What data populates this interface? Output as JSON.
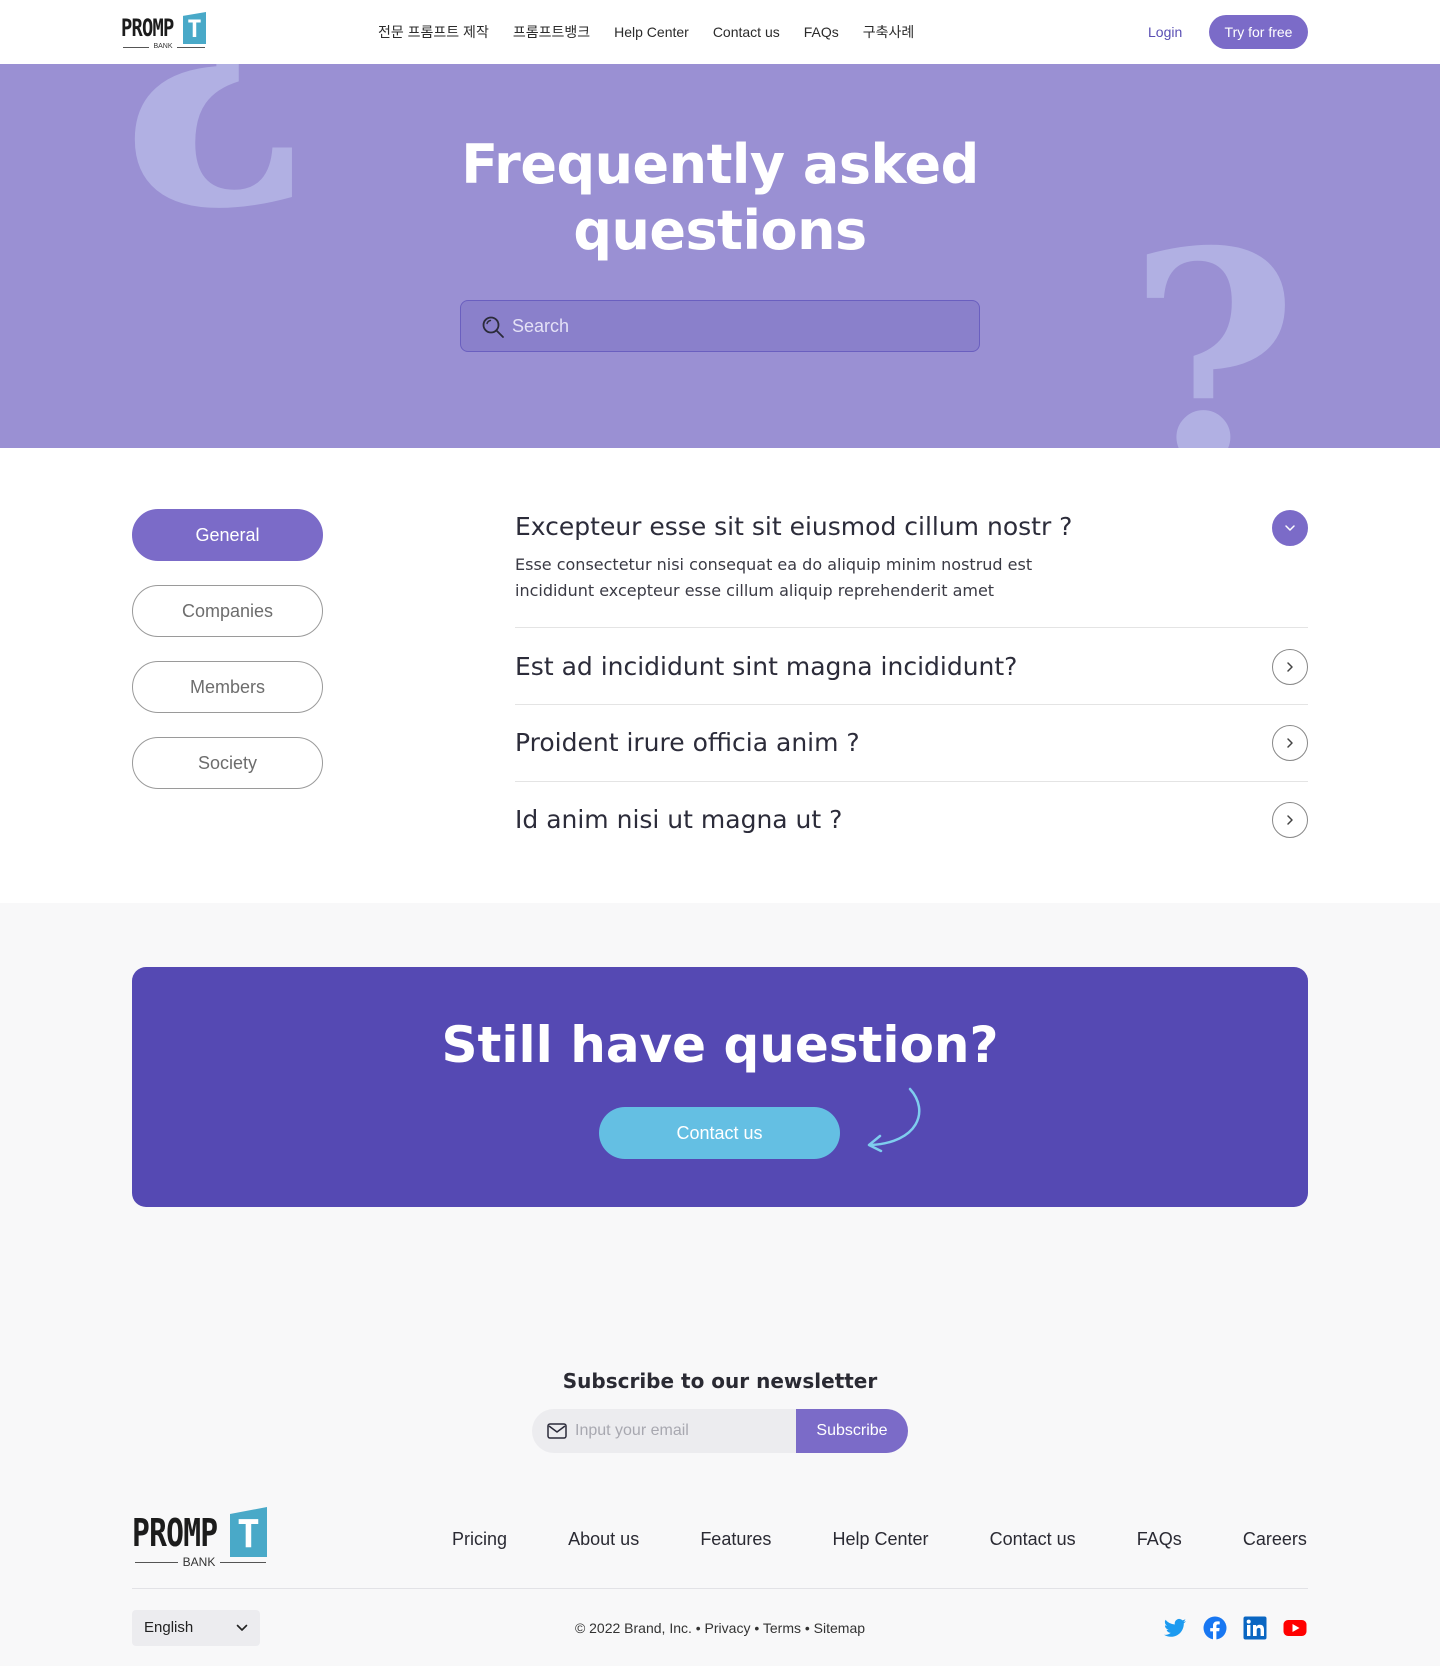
{
  "header": {
    "logo": {
      "word": "PROMP",
      "t_letter": "T",
      "sub": "BANK"
    },
    "nav": [
      "전문 프롬프트 제작",
      "프롬프트뱅크",
      "Help Center",
      "Contact us",
      "FAQs",
      "구축사례"
    ],
    "login": "Login",
    "cta": "Try for free"
  },
  "hero": {
    "title_line1": "Frequently asked",
    "title_line2": "questions",
    "search_placeholder": "Search",
    "decor_glyph": "?"
  },
  "categories": [
    "General",
    "Companies",
    "Members",
    "Society"
  ],
  "active_category": "General",
  "faq": [
    {
      "question": "Excepteur esse sit sit eiusmod cillum nostr ?",
      "answer_line1": "Esse consectetur nisi consequat ea do aliquip minim nostrud est",
      "answer_line2": "incididunt excepteur esse cillum aliquip reprehenderit amet",
      "expanded": true
    },
    {
      "question": "Est ad incididunt sint magna incididunt?",
      "expanded": false
    },
    {
      "question": "Proident irure officia anim ?",
      "expanded": false
    },
    {
      "question": "Id anim nisi ut magna ut ?",
      "expanded": false
    }
  ],
  "cta": {
    "title": "Still have question?",
    "button": "Contact us"
  },
  "newsletter": {
    "title": "Subscribe to our newsletter",
    "placeholder": "Input your email",
    "button": "Subscribe"
  },
  "footer": {
    "links": [
      "Pricing",
      "About us",
      "Features",
      "Help Center",
      "Contact us",
      "FAQs",
      "Careers"
    ],
    "language": "English",
    "copyright": "© 2022 Brand, Inc. • Privacy • Terms • Sitemap",
    "social_icons": [
      "twitter-icon",
      "facebook-icon",
      "linkedin-icon",
      "youtube-icon"
    ]
  },
  "colors": {
    "accent": "#7b6bc8",
    "hero_bg": "#9a90d3",
    "cta_bg": "#5549b3",
    "cta_button": "#64bfe3",
    "logo_teal": "#49a9c8"
  }
}
